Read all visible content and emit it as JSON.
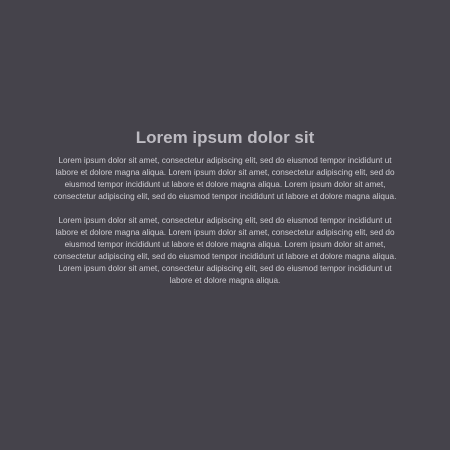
{
  "main": {
    "title": "Lorem ipsum dolor sit",
    "paragraphs": [
      "Lorem ipsum dolor sit amet, consectetur adipiscing elit, sed do eiusmod tempor incididunt ut labore et dolore magna aliqua. Lorem ipsum dolor sit amet, consectetur adipiscing elit, sed do eiusmod tempor incididunt ut labore et dolore magna aliqua. Lorem ipsum dolor sit amet, consectetur adipiscing elit, sed do eiusmod tempor incididunt ut labore et dolore magna aliqua.",
      "Lorem ipsum dolor sit amet, consectetur adipiscing elit, sed do eiusmod tempor incididunt ut labore et dolore magna aliqua. Lorem ipsum dolor sit amet, consectetur adipiscing elit, sed do eiusmod tempor incididunt ut labore et dolore magna aliqua. Lorem ipsum dolor sit amet, consectetur adipiscing elit, sed do eiusmod tempor incididunt ut labore et dolore magna aliqua. Lorem ipsum dolor sit amet, consectetur adipiscing elit, sed do eiusmod tempor incididunt ut labore et dolore magna aliqua."
    ]
  },
  "colors": {
    "background": "#45434b",
    "title": "#bdbbc2",
    "body_text": "#cfcdd3"
  }
}
